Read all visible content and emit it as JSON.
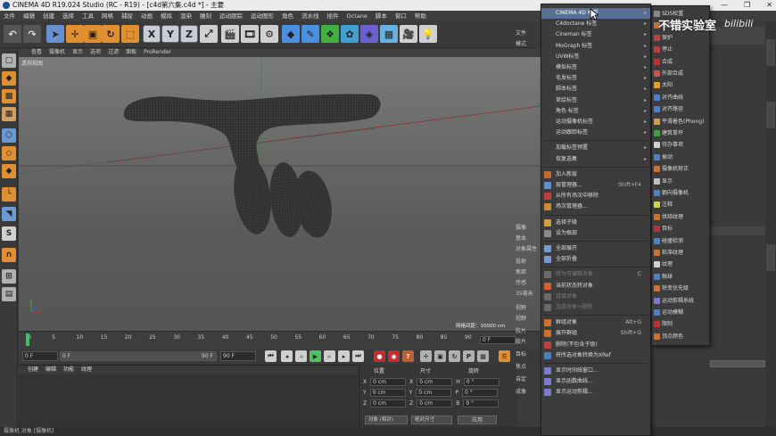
{
  "window": {
    "title": "CINEMA 4D R19.024 Studio (RC - R19) - [c4d第六集.c4d *] - 主要",
    "controls": [
      "—",
      "❐",
      "✕"
    ]
  },
  "menubar": [
    "文件",
    "编辑",
    "创建",
    "选择",
    "工具",
    "网格",
    "捕捉",
    "动画",
    "模拟",
    "渲染",
    "雕刻",
    "运动跟踪",
    "运动图形",
    "角色",
    "流水线",
    "插件",
    "Octane",
    "脚本",
    "窗口",
    "帮助"
  ],
  "toolbar": {
    "x": "X",
    "y": "Y",
    "z": "Z"
  },
  "viewport": {
    "menu": [
      "查看",
      "摄像机",
      "显示",
      "选项",
      "过滤",
      "面板",
      "ProRender"
    ],
    "label": "透视视图",
    "grid_spacing": "网格间距：10000 cm"
  },
  "timeline": {
    "ticks": [
      "0",
      "5",
      "10",
      "15",
      "20",
      "25",
      "30",
      "35",
      "40",
      "45",
      "50",
      "55",
      "60",
      "65",
      "70",
      "75",
      "80",
      "85",
      "90"
    ],
    "frame": "0 F"
  },
  "transport": {
    "start": "0 F",
    "current": "0 F",
    "end": "90 F",
    "end2": "90 F"
  },
  "material_panel": {
    "tabs": [
      "创建",
      "编辑",
      "功能",
      "纹理"
    ]
  },
  "coordinates": {
    "headers": {
      "position": "位置",
      "size": "尺寸",
      "rotation": "旋转"
    },
    "rows": [
      {
        "axis": "X",
        "pos": "0 cm",
        "size": "0 cm",
        "rot_axis": "H",
        "rot": "0 °"
      },
      {
        "axis": "Y",
        "pos": "0 cm",
        "size": "0 cm",
        "rot_axis": "P",
        "rot": "0 °"
      },
      {
        "axis": "Z",
        "pos": "0 cm",
        "size": "0 cm",
        "rot_axis": "B",
        "rot": "0 °"
      }
    ],
    "mode1": "对象 (相对)",
    "mode2": "绝对尺寸",
    "apply": "应用"
  },
  "status": "摄像机 对象 [摄像机]",
  "object_panel": {
    "labels": [
      "文件",
      "模式",
      "摄像",
      "基本",
      "对象属性",
      "投射",
      "焦距",
      "传感",
      "35毫米",
      "视野",
      "视野",
      "胶片",
      "胶片",
      "目标",
      "焦点",
      "自定",
      "成像"
    ]
  },
  "context_menu": {
    "items": [
      {
        "label": "CINEMA 4D 标签",
        "arrow": true,
        "selected": true
      },
      {
        "label": "C4doctane 标签",
        "arrow": true
      },
      {
        "label": "Cineman 标签",
        "arrow": true
      },
      {
        "label": "MoGraph 标签",
        "arrow": true
      },
      {
        "label": "UVW标签",
        "arrow": true
      },
      {
        "label": "模拟标签",
        "arrow": true
      },
      {
        "label": "毛发标签",
        "arrow": true
      },
      {
        "label": "脚本标签",
        "arrow": true
      },
      {
        "label": "草绘标签",
        "arrow": true
      },
      {
        "label": "角色 标签",
        "arrow": true
      },
      {
        "label": "运动摄像机标签",
        "arrow": true
      },
      {
        "label": "运动跟踪标签",
        "arrow": true
      },
      {
        "sep": true
      },
      {
        "label": "加载标签预置",
        "arrow": true
      },
      {
        "label": "恢复选集",
        "arrow": true
      },
      {
        "sep": true
      },
      {
        "label": "加入新层",
        "icon": "#c46a2a"
      },
      {
        "label": "层管理器...",
        "shortcut": "Shift+F4",
        "icon": "#5a8fd0"
      },
      {
        "label": "从所有场次中移除",
        "icon": "#c04040"
      },
      {
        "label": "场次管理器...",
        "icon": "#d08a30"
      },
      {
        "sep": true
      },
      {
        "label": "选择子级",
        "icon": "#d0a040"
      },
      {
        "label": "设为根部",
        "icon": "#8a8a8a"
      },
      {
        "sep": true
      },
      {
        "label": "全部展开",
        "icon": "#7a9ad0"
      },
      {
        "label": "全部折叠",
        "icon": "#7a9ad0"
      },
      {
        "sep": true
      },
      {
        "label": "转为可编辑对象",
        "shortcut": "C",
        "disabled": true,
        "icon": "#6a6a6a"
      },
      {
        "label": "当前状态转对象",
        "icon": "#d06030"
      },
      {
        "label": "连接对象",
        "disabled": true,
        "icon": "#6a6a6a"
      },
      {
        "label": "连接对象+删除",
        "disabled": true,
        "icon": "#6a6a6a"
      },
      {
        "sep": true
      },
      {
        "label": "群组对象",
        "shortcut": "Alt+G",
        "icon": "#d07030"
      },
      {
        "label": "展开群组",
        "shortcut": "Shift+G",
        "icon": "#d07030"
      },
      {
        "label": "删除(不包含子级)",
        "icon": "#c04040"
      },
      {
        "label": "将所选对象转换为XRef",
        "icon": "#4a80c0"
      },
      {
        "sep": true
      },
      {
        "label": "显示时间线窗口...",
        "icon": "#7a7ad0"
      },
      {
        "label": "显示函数曲线...",
        "icon": "#7a7ad0"
      },
      {
        "label": "显示运动剪辑...",
        "icon": "#7a7ad0"
      }
    ]
  },
  "submenu": {
    "items": [
      {
        "label": "SDS权重",
        "icon": "#888"
      },
      {
        "label": "交互标签",
        "icon": "#d06a30"
      },
      {
        "label": "保护",
        "icon": "#c04040"
      },
      {
        "label": "停止",
        "icon": "#c04040"
      },
      {
        "label": "合成",
        "icon": "#c03030"
      },
      {
        "label": "外部合成",
        "icon": "#d05050"
      },
      {
        "label": "太阳",
        "icon": "#e0a020"
      },
      {
        "label": "对齐曲线",
        "icon": "#4a80d0"
      },
      {
        "label": "对齐路径",
        "icon": "#4a80d0"
      },
      {
        "label": "平滑着色(Phong)",
        "icon": "#d0a040"
      },
      {
        "label": "建筑草坪",
        "icon": "#40a040"
      },
      {
        "label": "待办事项",
        "icon": "#d0d0d0"
      },
      {
        "label": "振动",
        "icon": "#4a80d0"
      },
      {
        "label": "摄像机矫正",
        "icon": "#d07030"
      },
      {
        "label": "显示",
        "icon": "#c0c0c0"
      },
      {
        "label": "朝向摄像机",
        "icon": "#4a80d0"
      },
      {
        "label": "注释",
        "icon": "#d0d050"
      },
      {
        "label": "烘焙纹理",
        "icon": "#d07030"
      },
      {
        "label": "目标",
        "icon": "#c03030"
      },
      {
        "label": "碰撞检测",
        "icon": "#4a80d0"
      },
      {
        "label": "粘滞纹理",
        "icon": "#d07030"
      },
      {
        "label": "纹理",
        "icon": "#d0d0d0"
      },
      {
        "label": "融球",
        "icon": "#4a80d0"
      },
      {
        "label": "矫变优先级",
        "icon": "#d07030"
      },
      {
        "label": "运动剪辑系统",
        "icon": "#7a7ad0"
      },
      {
        "label": "运动模糊",
        "icon": "#4a80d0"
      },
      {
        "label": "限制",
        "icon": "#c03030"
      },
      {
        "label": "顶点颜色",
        "icon": "#d07030"
      }
    ]
  },
  "watermark": {
    "text": "不错实验室",
    "brand": "bilibili"
  }
}
